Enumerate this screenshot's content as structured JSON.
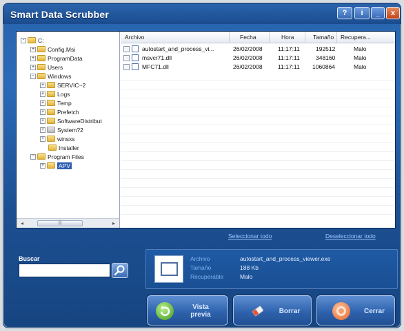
{
  "window": {
    "title": "Smart Data Scrubber",
    "title_buttons": [
      "?",
      "i",
      "_",
      "x"
    ]
  },
  "tree": {
    "items": [
      {
        "label": "C:",
        "expander": "-"
      },
      {
        "label": "Config.Msi",
        "expander": "+"
      },
      {
        "label": "ProgramData",
        "expander": "+"
      },
      {
        "label": "Users",
        "expander": "+"
      },
      {
        "label": "Windows",
        "expander": "-"
      },
      {
        "label": "SERVIC~2",
        "expander": "+"
      },
      {
        "label": "Logs",
        "expander": "+"
      },
      {
        "label": "Temp",
        "expander": "+"
      },
      {
        "label": "Prefetch",
        "expander": "+"
      },
      {
        "label": "SoftwareDistribut",
        "expander": "+"
      },
      {
        "label": "System?2",
        "expander": "+"
      },
      {
        "label": "winsxs",
        "expander": "+"
      },
      {
        "label": "Installer",
        "expander": ""
      },
      {
        "label": "Program Files",
        "expander": "-"
      },
      {
        "label": "APV",
        "expander": "+"
      }
    ],
    "scroll_thumb": "|||"
  },
  "list": {
    "columns": [
      "Archivo",
      "Fecha",
      "Hora",
      "Tamaño",
      "Recupera..."
    ],
    "rows": [
      {
        "archivo": "autostart_and_process_vi...",
        "fecha": "26/02/2008",
        "hora": "11:17:11",
        "tamano": "192512",
        "recupera": "Malo"
      },
      {
        "archivo": "msvcr71.dll",
        "fecha": "26/02/2008",
        "hora": "11:17:11",
        "tamano": "348160",
        "recupera": "Malo"
      },
      {
        "archivo": "MFC71.dll",
        "fecha": "26/02/2008",
        "hora": "11:17:11",
        "tamano": "1060864",
        "recupera": "Malo"
      }
    ]
  },
  "links": {
    "select_all": "Seleccionar todo",
    "deselect_all": "Deseleccionar todo"
  },
  "search": {
    "label": "Buscar",
    "value": ""
  },
  "details": {
    "labels": [
      "Archivo",
      "Tamaño",
      "Recuperable"
    ],
    "values": [
      "autostart_and_process_viewer.exe",
      "188 Kb",
      "Malo"
    ]
  },
  "actions": {
    "preview_line1": "Vista",
    "preview_line2": "previa",
    "delete": "Borrar",
    "close": "Cerrar"
  },
  "colors": {
    "window_blue": "#2a6ab8",
    "selection": "#2d5fb0",
    "link": "#9ec7ff",
    "info_label": "#7fb5f2"
  },
  "icons": {
    "preview": "refresh-arrow-icon",
    "delete": "eraser-icon",
    "close": "close-circle-icon",
    "search": "magnifier-icon"
  }
}
